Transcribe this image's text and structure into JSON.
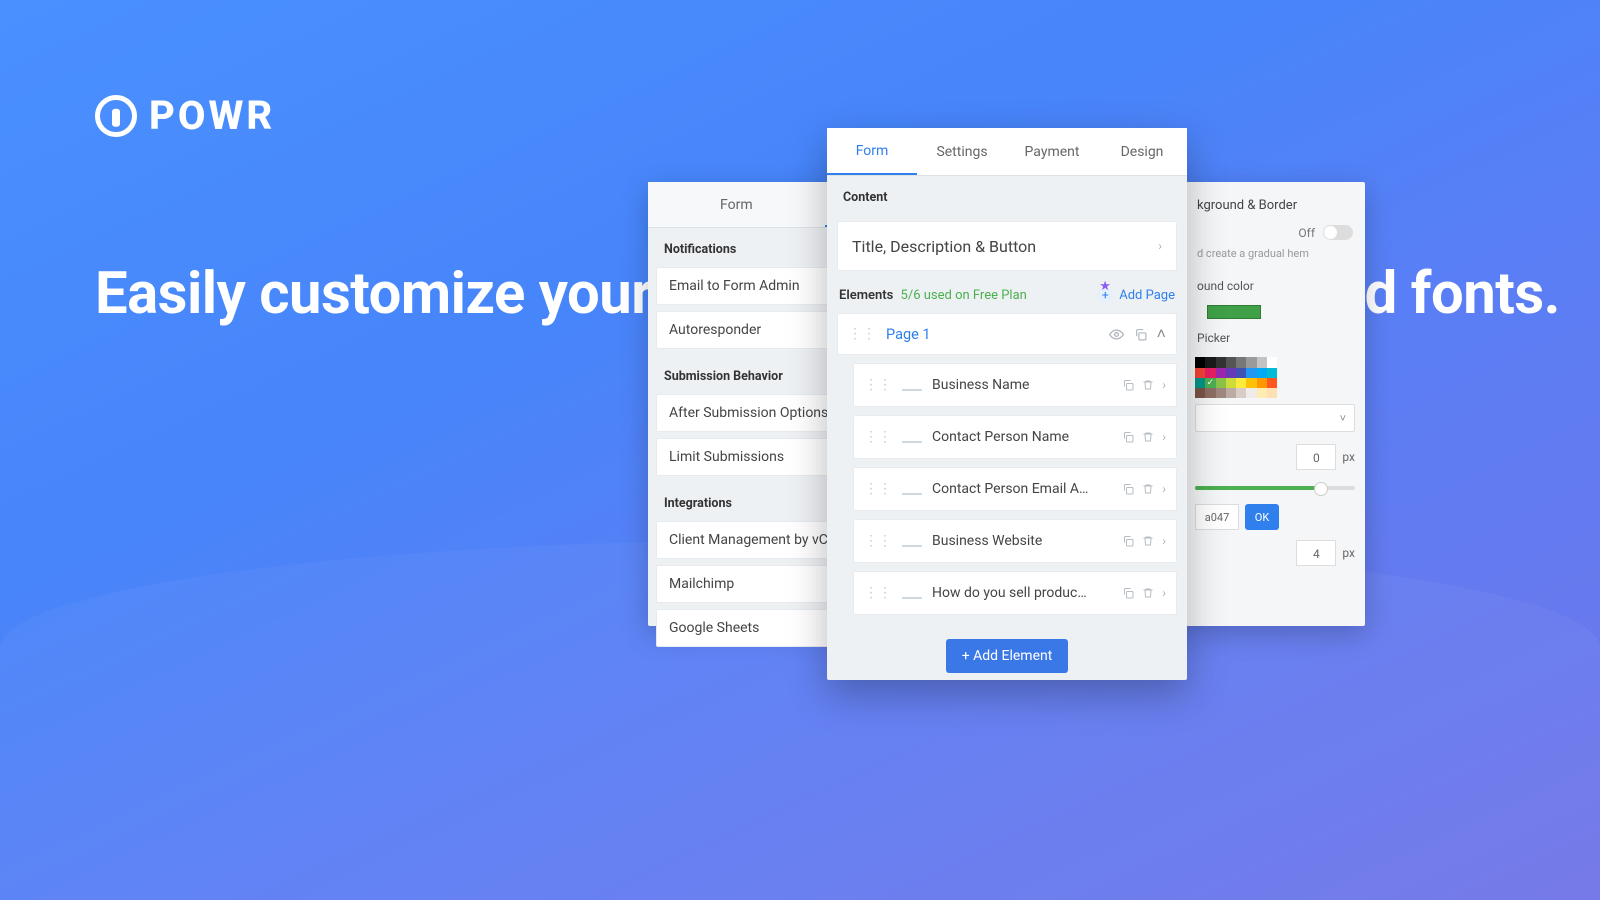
{
  "brand": "POWR",
  "headline": "Easily customize your layout, elements, colors, and fonts.",
  "settings_panel": {
    "tabs": [
      "Form",
      "Settings",
      "Payment"
    ],
    "active_tab": 1,
    "sections": {
      "notifications": {
        "title": "Notifications",
        "items": [
          "Email to Form Admin",
          "Autoresponder"
        ]
      },
      "submission": {
        "title": "Submission Behavior",
        "items": [
          "After Submission Options",
          "Limit Submissions"
        ]
      },
      "integrations": {
        "title": "Integrations",
        "items": [
          "Client Management by vCita",
          "Mailchimp",
          "Google Sheets"
        ]
      }
    }
  },
  "design_panel": {
    "title_fragment": "kground & Border",
    "toggle_label": "Off",
    "hint_fragment": "d create a gradual\nhem",
    "picker_label_fragment": "Picker",
    "ound_color_fragment": "ound color",
    "hex_fragment": "a047",
    "ok": "OK",
    "num0": "0",
    "num4": "4",
    "unit": "px",
    "palette": [
      [
        "#000000",
        "#1a1a1a",
        "#333333",
        "#555555",
        "#777777",
        "#9a9a9a",
        "#c3c3c3",
        "#ffffff"
      ],
      [
        "#f44336",
        "#e91e63",
        "#9c27b0",
        "#673ab7",
        "#3f51b5",
        "#2196f3",
        "#03a9f4",
        "#00bcd4"
      ],
      [
        "#009688",
        "#4caf50",
        "#8bc34a",
        "#cddc39",
        "#ffeb3b",
        "#ffc107",
        "#ff9800",
        "#ff5722"
      ],
      [
        "#795548",
        "#8d6e63",
        "#a1887f",
        "#bcaaa4",
        "#d7ccc8",
        "#efebe9",
        "#ffecb3",
        "#ffe0b2"
      ]
    ],
    "selected_swatch": "#4caf50"
  },
  "form_panel": {
    "tabs": [
      "Form",
      "Settings",
      "Payment",
      "Design"
    ],
    "active_tab": 0,
    "content_row": "Title, Description & Button",
    "content_head": "Content",
    "elements_label": "Elements",
    "elements_used": "5/6 used on Free Plan",
    "add_page": "Add Page",
    "page_name": "Page 1",
    "elements": [
      "Business Name",
      "Contact Person Name",
      "Contact Person Email A…",
      "Business Website",
      "How do you sell produc…"
    ],
    "add_element": "+ Add Element"
  }
}
